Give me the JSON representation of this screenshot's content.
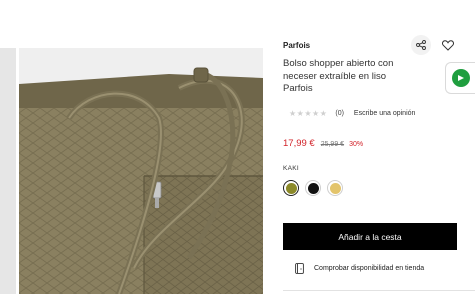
{
  "product": {
    "brand": "Parfois",
    "title": "Bolso shopper abierto con neceser extraíble en liso Parfois",
    "image_icon": "croc-bag-photo"
  },
  "actions": {
    "share_icon": "share-icon",
    "wishlist_icon": "heart-icon",
    "chat_icon": "chat-icon"
  },
  "rating": {
    "stars_glyph": "★★★★★",
    "value": 0,
    "count_label": "(0)",
    "write_review": "Escribe una opinión"
  },
  "price": {
    "current": "17,99 €",
    "original": "25,99 €",
    "discount": "30%",
    "accent_color": "#d2232a"
  },
  "colors": {
    "label": "KAKI",
    "options": [
      {
        "name": "kaki",
        "hex": "#8c8a2a",
        "selected": true
      },
      {
        "name": "black",
        "hex": "#111111",
        "selected": false
      },
      {
        "name": "yellow",
        "hex": "#e3c46b",
        "selected": false
      }
    ]
  },
  "cart": {
    "add_label": "Añadir a la cesta"
  },
  "store": {
    "check_label": "Comprobar disponibilidad en tienda",
    "icon": "store-icon"
  }
}
